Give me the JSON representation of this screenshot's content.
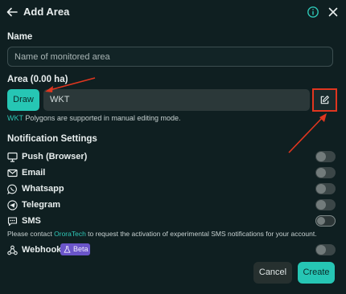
{
  "header": {
    "title": "Add Area"
  },
  "name_section": {
    "label": "Name",
    "placeholder": "Name of monitored area"
  },
  "area_section": {
    "label": "Area (0.00 ha)",
    "draw_label": "Draw",
    "wkt_value": "WKT",
    "hint_prefix": "WKT",
    "hint_rest": " Polygons are supported in manual editing mode."
  },
  "notifications": {
    "title": "Notification Settings",
    "items": [
      {
        "label": "Push (Browser)",
        "icon": "monitor-icon"
      },
      {
        "label": "Email",
        "icon": "email-icon"
      },
      {
        "label": "Whatsapp",
        "icon": "whatsapp-icon"
      },
      {
        "label": "Telegram",
        "icon": "telegram-icon"
      },
      {
        "label": "SMS",
        "icon": "sms-icon"
      }
    ],
    "note_prefix": "Please contact ",
    "note_link": "OroraTech",
    "note_suffix": " to request the activation of experimental SMS notifications for your account.",
    "webhook": {
      "label": "Webhook",
      "badge": "Beta",
      "icon": "webhook-icon"
    }
  },
  "footer": {
    "cancel_label": "Cancel",
    "create_label": "Create"
  },
  "colors": {
    "accent": "#26c6b4",
    "annotation": "#e0361f",
    "beta": "#6a55c9"
  }
}
